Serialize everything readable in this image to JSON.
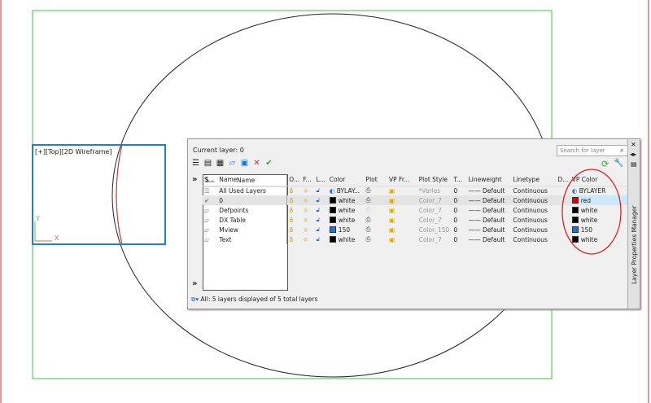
{
  "viewport": {
    "label": "[+][Top][2D Wireframe]",
    "ucs_x": "X",
    "ucs_y": "Y"
  },
  "panel": {
    "title": "Layer Properties Manager",
    "current_layer": "Current layer: 0",
    "search_placeholder": "Search for layer",
    "columns": [
      "O...",
      "F...",
      "L...",
      "Color",
      "Plot",
      "VP Fr...",
      "Plot Style",
      "T...",
      "Lineweight",
      "Linetype",
      "D...",
      "VP Color"
    ],
    "tree": {
      "headers": [
        "S...",
        "Name"
      ],
      "all_used": "All Used Layers"
    },
    "layers": [
      {
        "name": "0",
        "color": "white",
        "color_hex": "#000000",
        "plot_style": "Color_7",
        "t": "0",
        "lineweight": "Default",
        "linetype": "Continuous",
        "vp_color": "red",
        "vp_hex": "#e00000",
        "selected": true
      },
      {
        "name": "Defpoints",
        "color": "white",
        "color_hex": "#000000",
        "plot_style": "Color_7",
        "t": "0",
        "lineweight": "Default",
        "linetype": "Continuous",
        "vp_color": "white",
        "vp_hex": "#000000"
      },
      {
        "name": "DX Table",
        "color": "white",
        "color_hex": "#000000",
        "plot_style": "Color_7",
        "t": "0",
        "lineweight": "Default",
        "linetype": "Continuous",
        "vp_color": "white",
        "vp_hex": "#000000"
      },
      {
        "name": "Mview",
        "color": "150",
        "color_hex": "#1a73e0",
        "plot_style": "Color_150",
        "t": "0",
        "lineweight": "Default",
        "linetype": "Continuous",
        "vp_color": "150",
        "vp_hex": "#1a73e0"
      },
      {
        "name": "Text",
        "color": "white",
        "color_hex": "#000000",
        "plot_style": "Color_7",
        "t": "0",
        "lineweight": "Default",
        "linetype": "Continuous",
        "vp_color": "white",
        "vp_hex": "#000000"
      }
    ],
    "all_row": {
      "color": "BYLAY...",
      "plot_style": "*Varies",
      "t": "0",
      "lineweight": "Default",
      "linetype": "Continuous",
      "vp_color": "BYLAYER"
    },
    "status": "All: 5 layers displayed of 5 total layers"
  }
}
